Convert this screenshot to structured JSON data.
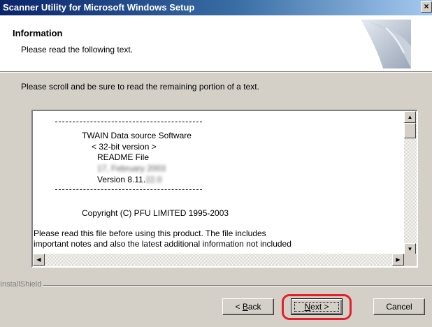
{
  "window": {
    "title": "Scanner Utility for Microsoft Windows Setup",
    "close_label": "×"
  },
  "header": {
    "title": "Information",
    "subtitle": "Please read the following text."
  },
  "instruction": "Please scroll and be sure to read the remaining portion of a text.",
  "readme": {
    "line1": "TWAIN Data source Software",
    "line2": "< 32-bit version >",
    "line3": "README File",
    "date_blurred": "17, February 2003",
    "version_prefix": "Version 8.11.",
    "version_blurred": "22.0",
    "copyright": "Copyright (C) PFU LIMITED 1995-2003",
    "body_line1": "Please read this file before using this product.  The file includes",
    "body_line2": "important notes and also the latest additional information not included"
  },
  "scrollbar": {
    "up_icon": "▲",
    "down_icon": "▼",
    "left_icon": "◀",
    "right_icon": "▶"
  },
  "footer": {
    "brand": "InstallShield"
  },
  "buttons": {
    "back_prefix": "< ",
    "back_accel": "B",
    "back_rest": "ack",
    "next_accel": "N",
    "next_rest": "ext >",
    "cancel": "Cancel"
  },
  "colors": {
    "title_gradient_start": "#0a246a",
    "dialog_face": "#d4d0c8",
    "highlight_ring": "#e3202a"
  }
}
